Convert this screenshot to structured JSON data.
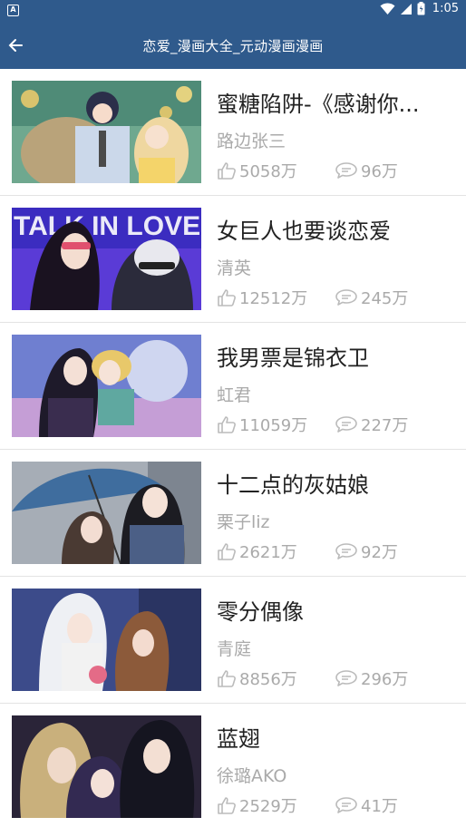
{
  "status_bar": {
    "time": "1:05",
    "notif_label": "A"
  },
  "header": {
    "title": "恋爱_漫画大全_元动漫画漫画"
  },
  "items": [
    {
      "title": "蜜糖陷阱-《感谢你...",
      "author": "路边张三",
      "likes": "5058万",
      "comments": "96万"
    },
    {
      "title": "女巨人也要谈恋爱",
      "author": "清英",
      "likes": "12512万",
      "comments": "245万"
    },
    {
      "title": "我男票是锦衣卫",
      "author": "虹君",
      "likes": "11059万",
      "comments": "227万"
    },
    {
      "title": "十二点的灰姑娘",
      "author": "栗子liz",
      "likes": "2621万",
      "comments": "92万"
    },
    {
      "title": "零分偶像",
      "author": "青庭",
      "likes": "8856万",
      "comments": "296万"
    },
    {
      "title": "蓝翅",
      "author": "徐璐AKO",
      "likes": "2529万",
      "comments": "41万"
    }
  ],
  "cover_texts": {
    "item_2": "TALK IN LOVE"
  },
  "colors": {
    "app_bar": "#2f5a8c",
    "divider": "#e3e3e3",
    "meta_text": "#aaaaaa",
    "title_text": "#222222"
  }
}
